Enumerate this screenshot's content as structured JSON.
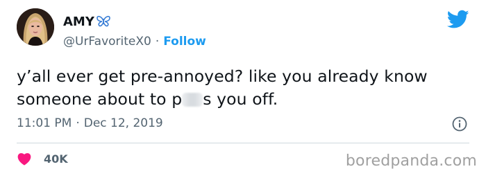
{
  "tweet": {
    "author_name": "AMY",
    "author_handle": "@UrFavoriteX0",
    "separator": "·",
    "follow_label": "Follow",
    "text_before_censor": "y’all ever get pre-annoyed? like you already know someone about to p",
    "text_after_censor": "s you off.",
    "time": "11:01 PM",
    "date": "Dec 12, 2019",
    "like_count": "40K"
  },
  "icons": {
    "avatar": "avatar-photo",
    "badge": "butterfly-icon",
    "brand": "twitter-bird-icon",
    "info": "info-icon",
    "like": "heart-icon"
  },
  "watermark": "boredpanda.com",
  "colors": {
    "accent": "#1d9bf0",
    "butterfly": "#3b7fd6",
    "heart": "#f91880",
    "secondary_text": "#536471",
    "divider": "#cfd9de",
    "watermark": "#a0a0a0"
  }
}
